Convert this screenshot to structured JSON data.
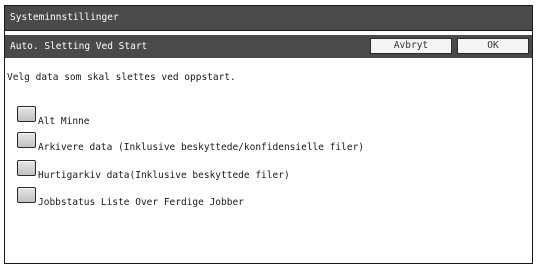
{
  "window": {
    "title": "Systeminnstillinger"
  },
  "header": {
    "subtitle": "Auto. Sletting Ved Start",
    "cancel_label": "Avbryt",
    "ok_label": "OK"
  },
  "main": {
    "instruction": "Velg data som skal slettes ved oppstart.",
    "options": [
      {
        "label": "Alt Minne",
        "checked": false
      },
      {
        "label": "Arkivere data (Inklusive beskyttede/konfidensielle filer)",
        "checked": false
      },
      {
        "label": "Hurtigarkiv data(Inklusive beskyttede filer)",
        "checked": false
      },
      {
        "label": "Jobbstatus Liste Over Ferdige Jobber",
        "checked": false
      }
    ]
  },
  "colors": {
    "title_bar": "#4a4a4a",
    "border": "#1a1a1a",
    "checkbox": "#d4d4d4",
    "button": "#f4f4f4"
  }
}
